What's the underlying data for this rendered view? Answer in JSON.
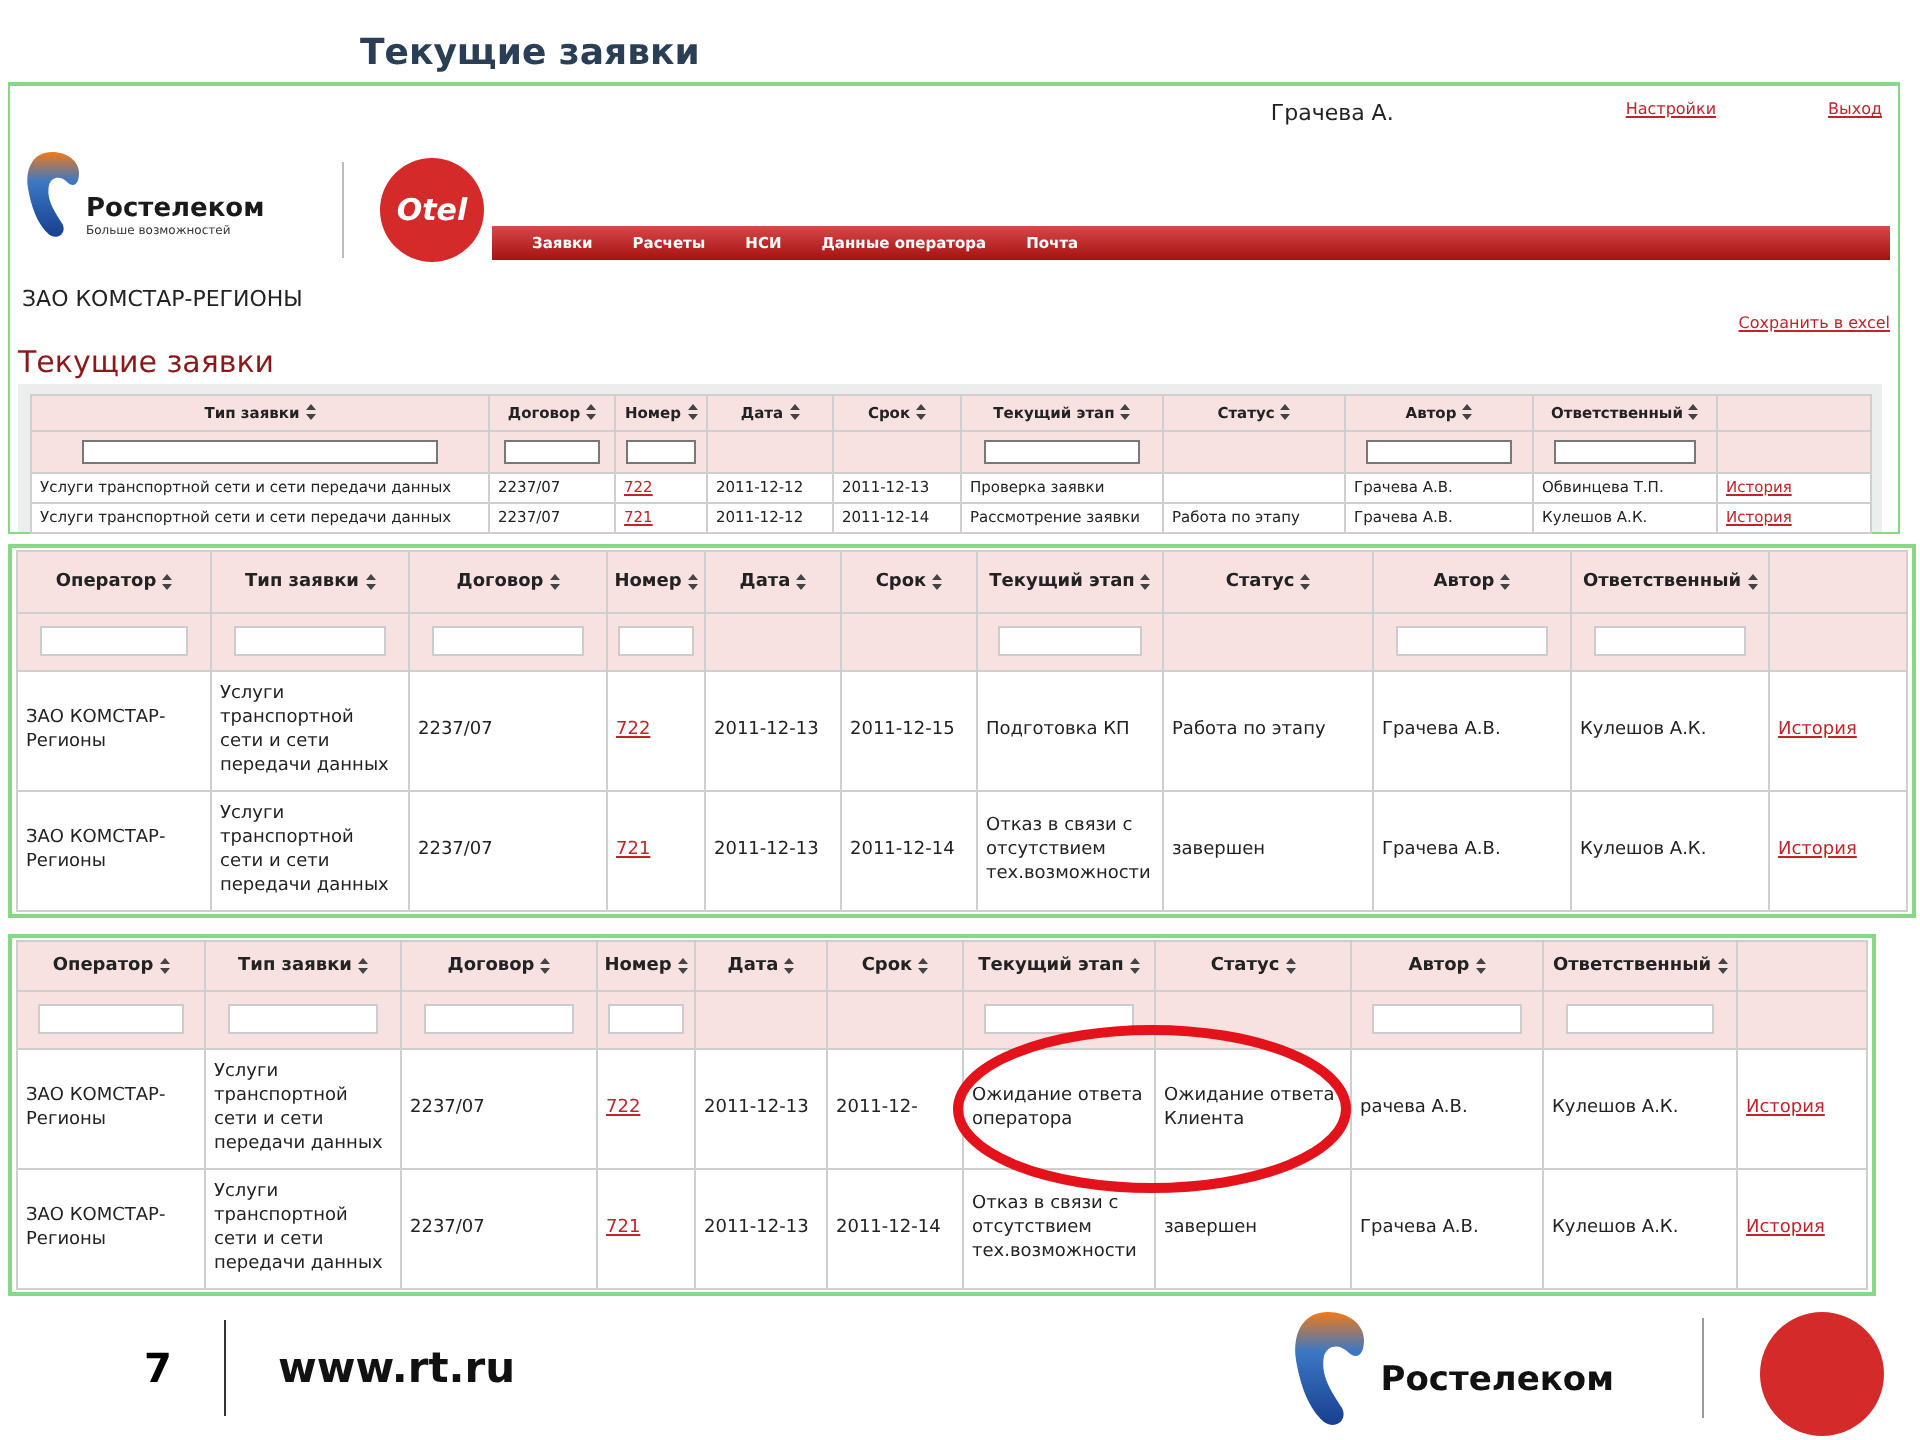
{
  "slide_title": "Текущие заявки",
  "app": {
    "user": "Грачева А.",
    "links": [
      "Настройки",
      "Выход"
    ],
    "logo": {
      "name": "Ростелеком",
      "tagline": "Больше возможностей"
    },
    "partner_logo": "Otel",
    "nav": [
      "Заявки",
      "Расчеты",
      "НСИ",
      "Данные оператора",
      "Почта"
    ],
    "organization": "ЗАО КОМСТАР-РЕГИОНЫ",
    "export_link": "Сохранить в excel",
    "heading": "Текущие заявки"
  },
  "tables": [
    {
      "columns": [
        {
          "label": "Тип заявки",
          "sortable": true,
          "filter": true,
          "kind": "text"
        },
        {
          "label": "Договор",
          "sortable": true,
          "filter": true,
          "kind": "text"
        },
        {
          "label": "Номер",
          "sortable": true,
          "filter": true,
          "kind": "link"
        },
        {
          "label": "Дата",
          "sortable": true,
          "filter": false,
          "kind": "text"
        },
        {
          "label": "Срок",
          "sortable": true,
          "filter": false,
          "kind": "text"
        },
        {
          "label": "Текущий этап",
          "sortable": true,
          "filter": true,
          "kind": "text"
        },
        {
          "label": "Статус",
          "sortable": true,
          "filter": false,
          "kind": "text"
        },
        {
          "label": "Автор",
          "sortable": true,
          "filter": true,
          "kind": "text"
        },
        {
          "label": "Ответственный",
          "sortable": true,
          "filter": true,
          "kind": "text"
        },
        {
          "sortable": false,
          "filter": false,
          "kind": "link"
        }
      ],
      "rows": [
        {
          "highlighted": false,
          "cells": [
            "Услуги транспортной сети и сети передачи данных",
            "2237/07",
            "722",
            "2011-12-12",
            "2011-12-13",
            "Проверка заявки",
            null,
            "Грачева А.В.",
            "Обвинцева Т.П.",
            "История"
          ]
        },
        {
          "highlighted": false,
          "cells": [
            "Услуги транспортной сети и сети передачи данных",
            "2237/07",
            "721",
            "2011-12-12",
            "2011-12-14",
            "Рассмотрение заявки",
            "Работа по этапу",
            "Грачева А.В.",
            "Кулешов А.К.",
            "История"
          ]
        }
      ]
    },
    {
      "columns": [
        {
          "label": "Оператор",
          "sortable": true,
          "filter": true,
          "kind": "text"
        },
        {
          "label": "Тип заявки",
          "sortable": true,
          "filter": true,
          "kind": "text"
        },
        {
          "label": "Договор",
          "sortable": true,
          "filter": true,
          "kind": "text"
        },
        {
          "label": "Номер",
          "sortable": true,
          "filter": true,
          "kind": "link"
        },
        {
          "label": "Дата",
          "sortable": true,
          "filter": false,
          "kind": "text"
        },
        {
          "label": "Срок",
          "sortable": true,
          "filter": false,
          "kind": "text"
        },
        {
          "label": "Текущий этап",
          "sortable": true,
          "filter": true,
          "kind": "text"
        },
        {
          "label": "Статус",
          "sortable": true,
          "filter": false,
          "kind": "text"
        },
        {
          "label": "Автор",
          "sortable": true,
          "filter": true,
          "kind": "text"
        },
        {
          "label": "Ответственный",
          "sortable": true,
          "filter": true,
          "kind": "text"
        },
        {
          "sortable": false,
          "filter": false,
          "kind": "link"
        }
      ],
      "rows": [
        {
          "highlighted": false,
          "cells": [
            "ЗАО КОМСТАР-Регионы",
            "Услуги транспортной сети и сети передачи данных",
            "2237/07",
            "722",
            "2011-12-13",
            "2011-12-15",
            "Подготовка КП",
            "Работа по этапу",
            "Грачева А.В.",
            "Кулешов А.К.",
            "История"
          ]
        },
        {
          "highlighted": false,
          "cells": [
            "ЗАО КОМСТАР-Регионы",
            "Услуги транспортной сети и сети передачи данных",
            "2237/07",
            "721",
            "2011-12-13",
            "2011-12-14",
            "Отказ в связи с отсутствием тех.возможности",
            "завершен",
            "Грачева А.В.",
            "Кулешов А.К.",
            "История"
          ]
        }
      ]
    },
    {
      "columns": [
        {
          "label": "Оператор",
          "sortable": true,
          "filter": true,
          "kind": "text"
        },
        {
          "label": "Тип заявки",
          "sortable": true,
          "filter": true,
          "kind": "text"
        },
        {
          "label": "Договор",
          "sortable": true,
          "filter": true,
          "kind": "text"
        },
        {
          "label": "Номер",
          "sortable": true,
          "filter": true,
          "kind": "link"
        },
        {
          "label": "Дата",
          "sortable": true,
          "filter": false,
          "kind": "text"
        },
        {
          "label": "Срок",
          "sortable": true,
          "filter": false,
          "kind": "text"
        },
        {
          "label": "Текущий этап",
          "sortable": true,
          "filter": true,
          "kind": "text"
        },
        {
          "label": "Статус",
          "sortable": true,
          "filter": false,
          "kind": "text"
        },
        {
          "label": "Автор",
          "sortable": true,
          "filter": true,
          "kind": "text"
        },
        {
          "label": "Ответственный",
          "sortable": true,
          "filter": true,
          "kind": "text"
        },
        {
          "sortable": false,
          "filter": false,
          "kind": "link"
        }
      ],
      "rows": [
        {
          "highlighted": true,
          "cells": [
            "ЗАО КОМСТАР-Регионы",
            "Услуги транспортной сети и сети передачи данных",
            "2237/07",
            "722",
            "2011-12-13",
            "2011-12-",
            "Ожидание ответа оператора",
            "Ожидание ответа Клиента",
            "рачева А.В.",
            "Кулешов А.К.",
            "История"
          ]
        },
        {
          "highlighted": false,
          "cells": [
            "ЗАО КОМСТАР-Регионы",
            "Услуги транспортной сети и сети передачи данных",
            "2237/07",
            "721",
            "2011-12-13",
            "2011-12-14",
            "Отказ в связи с отсутствием тех.возможности",
            "завершен",
            "Грачева А.В.",
            "Кулешов А.К.",
            "История"
          ]
        }
      ]
    }
  ],
  "footer": {
    "page": "7",
    "url": "www.rt.ru",
    "logo": "Ростелеком"
  }
}
